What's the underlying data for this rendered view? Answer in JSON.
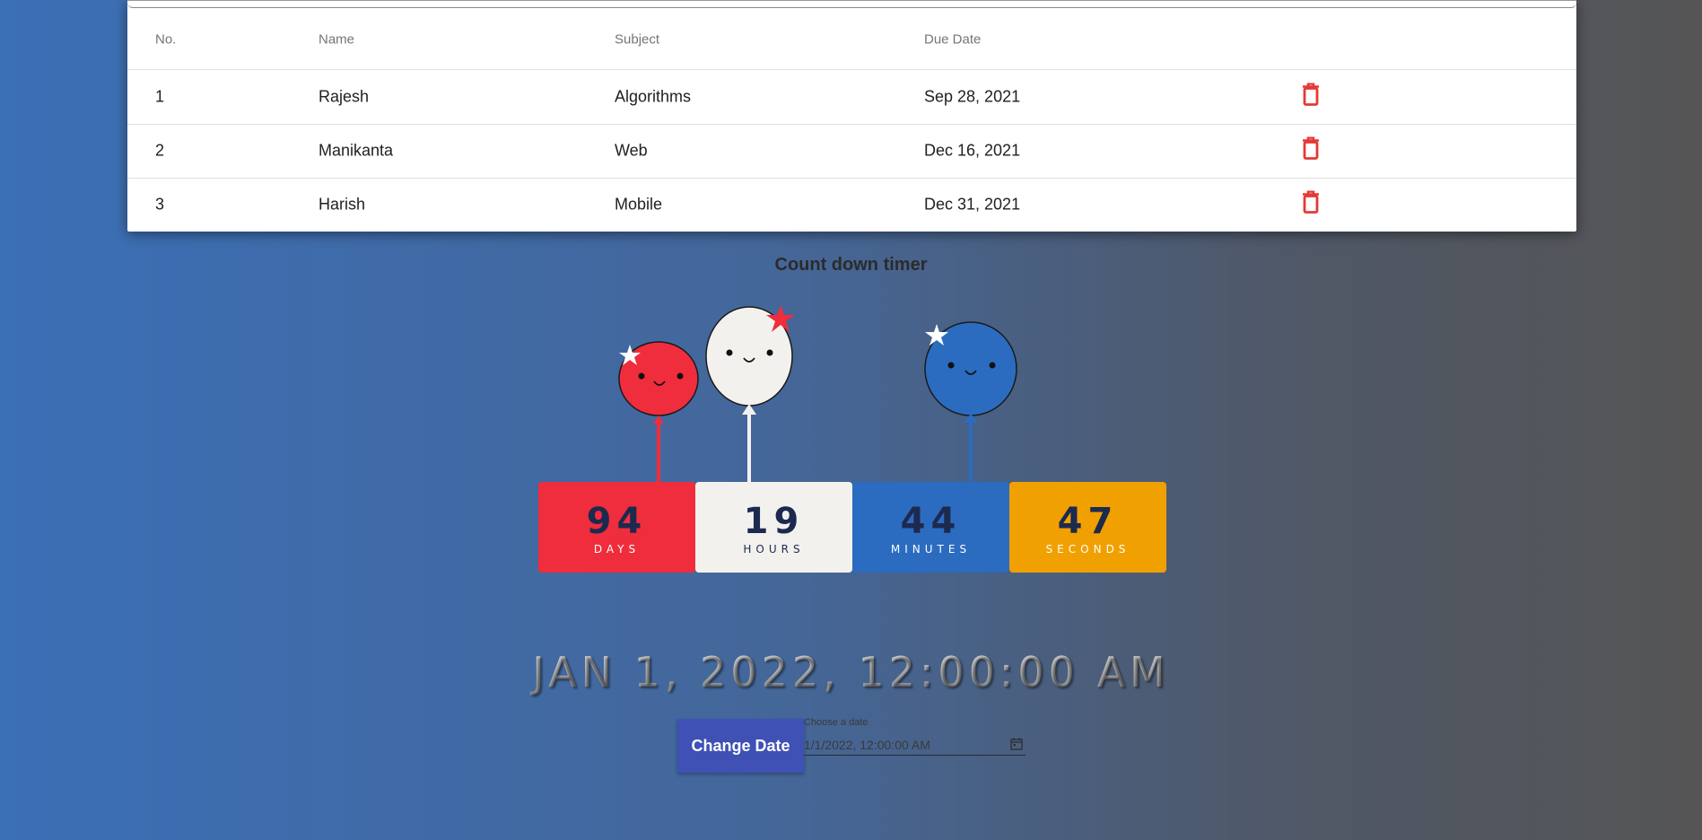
{
  "table": {
    "headers": [
      "No.",
      "Name",
      "Subject",
      "Due Date"
    ],
    "rows": [
      {
        "no": "1",
        "name": "Rajesh",
        "subject": "Algorithms",
        "due": "Sep 28, 2021"
      },
      {
        "no": "2",
        "name": "Manikanta",
        "subject": "Web",
        "due": "Dec 16, 2021"
      },
      {
        "no": "3",
        "name": "Harish",
        "subject": "Mobile",
        "due": "Dec 31, 2021"
      }
    ],
    "delete_icon": "trash-icon"
  },
  "timer": {
    "title": "Count down timer",
    "days": {
      "value": "94",
      "label": "DAYS",
      "color": "#ef2d3c"
    },
    "hours": {
      "value": "19",
      "label": "HOURS",
      "color": "#f3f1ee"
    },
    "minutes": {
      "value": "44",
      "label": "MINUTES",
      "color": "#2b6cc0"
    },
    "seconds": {
      "value": "47",
      "label": "SECONDS",
      "color": "#f0a000"
    },
    "target_date": "JAN 1, 2022, 12:00:00 AM"
  },
  "controls": {
    "change_button": "Change Date",
    "date_label": "Choose a date",
    "date_value": "1/1/2022, 12:00:00 AM",
    "calendar_icon": "calendar-icon",
    "accent": "#3f51b5"
  }
}
